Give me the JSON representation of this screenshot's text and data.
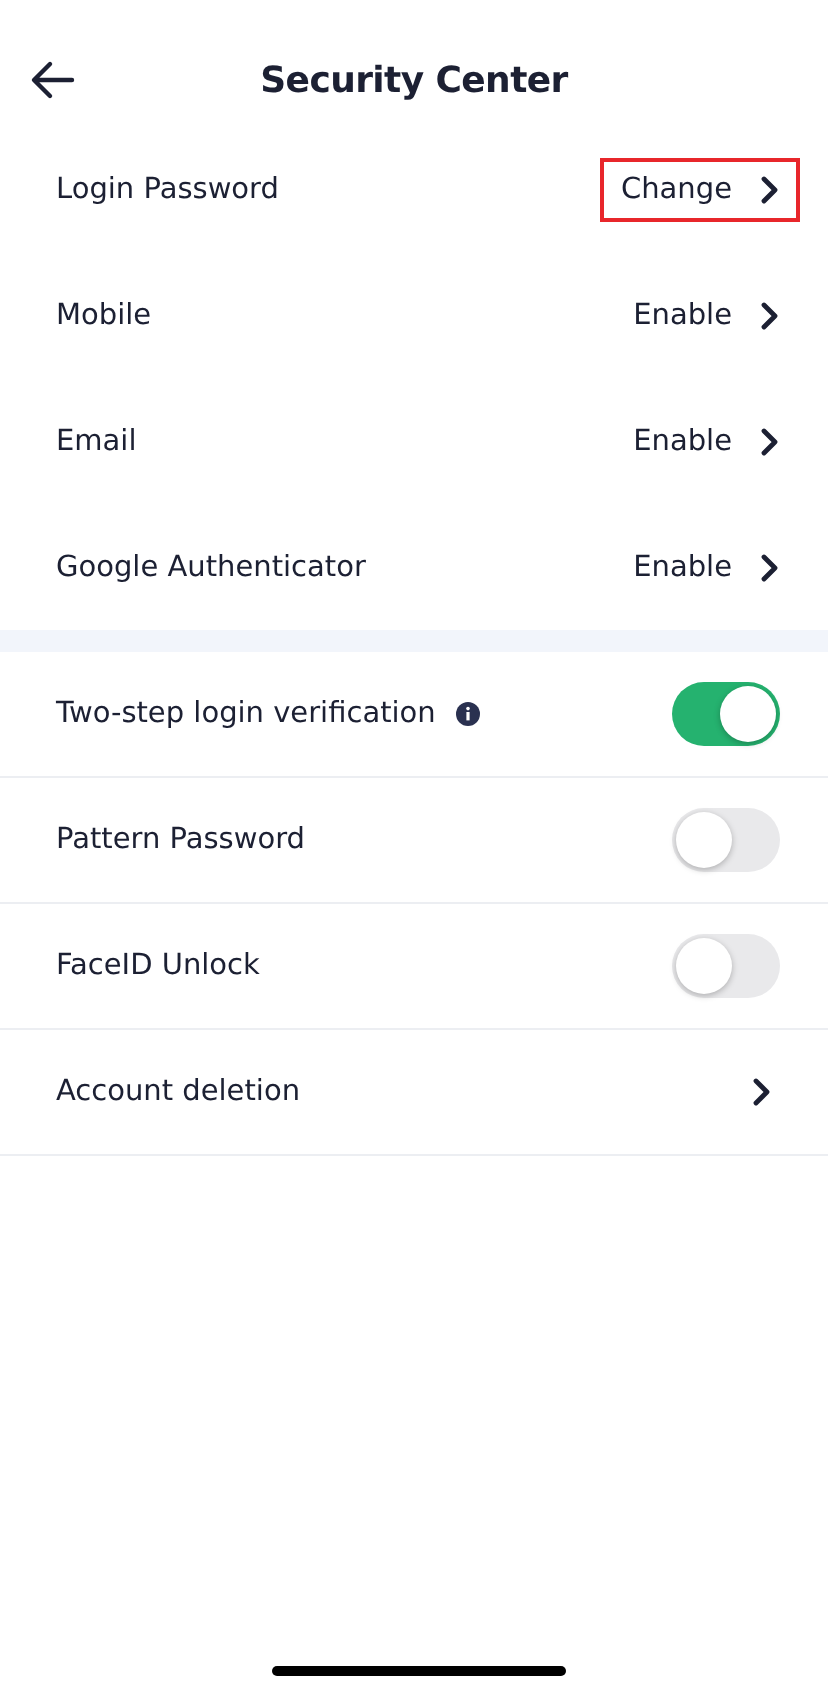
{
  "header": {
    "title": "Security Center"
  },
  "security_items": [
    {
      "label": "Login Password",
      "value": "Change",
      "highlighted": true
    },
    {
      "label": "Mobile",
      "value": "Enable",
      "highlighted": false
    },
    {
      "label": "Email",
      "value": "Enable",
      "highlighted": false
    },
    {
      "label": "Google Authenticator",
      "value": "Enable",
      "highlighted": false
    }
  ],
  "settings": [
    {
      "kind": "toggle",
      "label": "Two-step login verification",
      "info": true,
      "on": true
    },
    {
      "kind": "toggle",
      "label": "Pattern Password",
      "info": false,
      "on": false
    },
    {
      "kind": "toggle",
      "label": "FaceID Unlock",
      "info": false,
      "on": false
    },
    {
      "kind": "link",
      "label": "Account deletion",
      "info": false
    }
  ]
}
